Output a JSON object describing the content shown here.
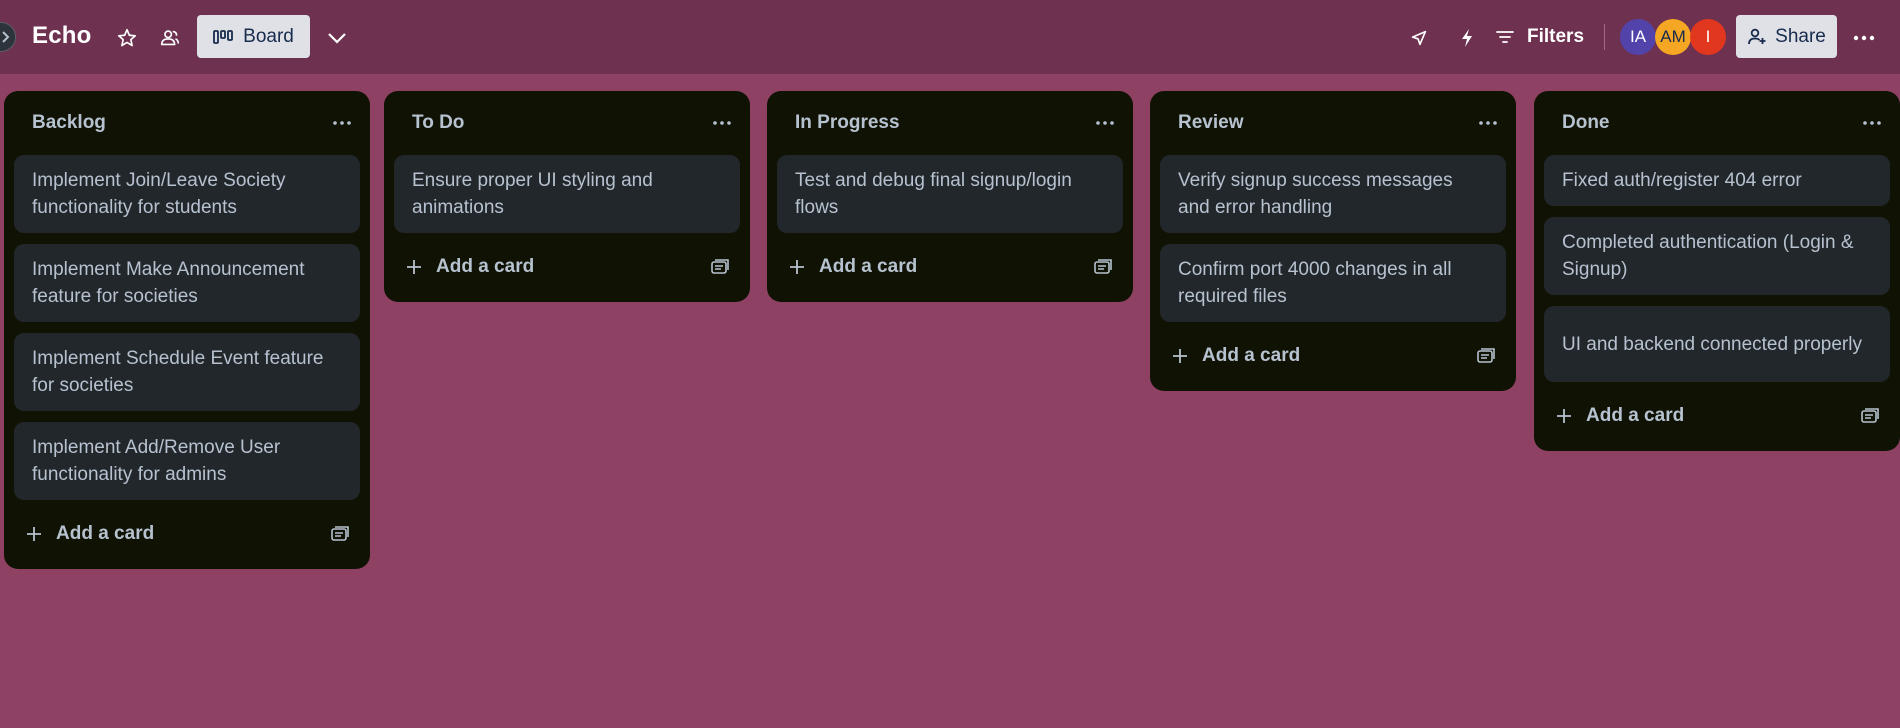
{
  "header": {
    "title": "Echo",
    "view_label": "Board",
    "filters_label": "Filters",
    "share_label": "Share",
    "avatars": [
      {
        "initials": "IA",
        "color": "#5243aa"
      },
      {
        "initials": "AM",
        "color": "#f5a623"
      },
      {
        "initials": "I",
        "color": "#e2371f"
      }
    ]
  },
  "add_card_label": "Add a card",
  "lists": [
    {
      "title": "Backlog",
      "cards": [
        "Implement Join/Leave Society functionality for students",
        "Implement Make Announcement feature for societies",
        "Implement Schedule Event feature for societies",
        "Implement Add/Remove User functionality for admins"
      ]
    },
    {
      "title": "To Do",
      "cards": [
        "Ensure proper UI styling and animations"
      ]
    },
    {
      "title": "In Progress",
      "cards": [
        "Test and debug final signup/login flows"
      ]
    },
    {
      "title": "Review",
      "cards": [
        "Verify signup success messages and error handling",
        "Confirm port 4000 changes in all required files"
      ]
    },
    {
      "title": "Done",
      "cards": [
        "Fixed auth/register 404 error",
        "Completed authentication (Login & Signup)",
        "UI and backend connected properly"
      ]
    }
  ]
}
